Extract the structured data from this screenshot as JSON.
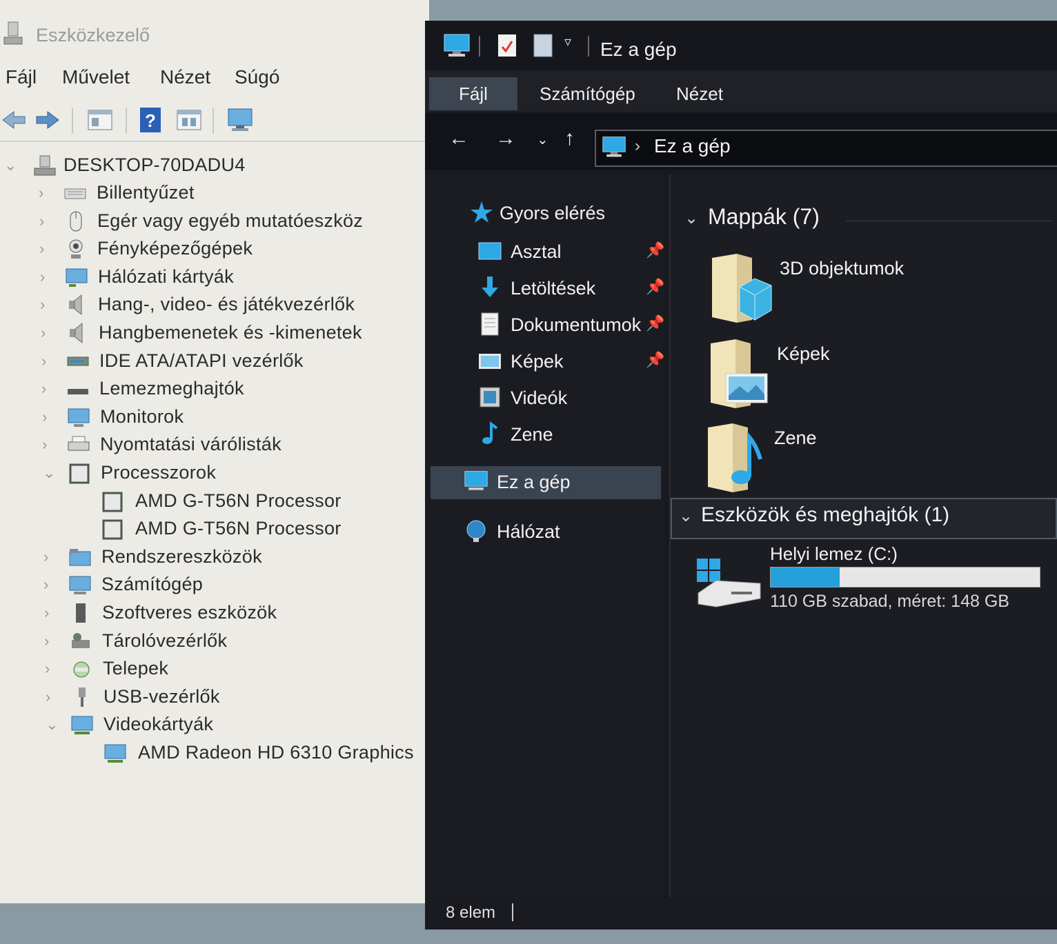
{
  "device_manager": {
    "title": "Eszközkezelő",
    "menu": [
      "Fájl",
      "Művelet",
      "Nézet",
      "Súgó"
    ],
    "toolbar_icons": [
      "back-arrow-icon",
      "forward-arrow-icon",
      "properties-icon",
      "help-icon",
      "update-driver-icon",
      "scan-hardware-icon"
    ],
    "root": "DESKTOP-70DADU4",
    "categories": [
      {
        "label": "Billentyűzet",
        "icon": "keyboard-icon",
        "expanded": false
      },
      {
        "label": "Egér vagy egyéb mutatóeszköz",
        "icon": "mouse-icon",
        "expanded": false
      },
      {
        "label": "Fényképezőgépek",
        "icon": "camera-icon",
        "expanded": false
      },
      {
        "label": "Hálózati kártyák",
        "icon": "network-adapter-icon",
        "expanded": false
      },
      {
        "label": "Hang-, video- és játékvezérlők",
        "icon": "speaker-icon",
        "expanded": false
      },
      {
        "label": "Hangbemenetek és -kimenetek",
        "icon": "speaker-icon",
        "expanded": false
      },
      {
        "label": "IDE ATA/ATAPI vezérlők",
        "icon": "ide-controller-icon",
        "expanded": false
      },
      {
        "label": "Lemezmeghajtók",
        "icon": "disk-drive-icon",
        "expanded": false
      },
      {
        "label": "Monitorok",
        "icon": "monitor-icon",
        "expanded": false
      },
      {
        "label": "Nyomtatási várólisták",
        "icon": "printer-icon",
        "expanded": false
      },
      {
        "label": "Processzorok",
        "icon": "processor-icon",
        "expanded": true,
        "children": [
          "AMD G-T56N Processor",
          "AMD G-T56N Processor"
        ]
      },
      {
        "label": "Rendszereszközök",
        "icon": "system-devices-icon",
        "expanded": false
      },
      {
        "label": "Számítógép",
        "icon": "computer-icon",
        "expanded": false
      },
      {
        "label": "Szoftveres eszközök",
        "icon": "software-device-icon",
        "expanded": false
      },
      {
        "label": "Tárolóvezérlők",
        "icon": "storage-controller-icon",
        "expanded": false
      },
      {
        "label": "Telepek",
        "icon": "battery-icon",
        "expanded": false
      },
      {
        "label": "USB-vezérlők",
        "icon": "usb-icon",
        "expanded": false
      },
      {
        "label": "Videokártyák",
        "icon": "display-adapter-icon",
        "expanded": true,
        "children": [
          "AMD Radeon HD 6310 Graphics"
        ]
      }
    ]
  },
  "explorer": {
    "title": "Ez a gép",
    "ribbon_tabs": [
      "Fájl",
      "Számítógép",
      "Nézet"
    ],
    "address": "Ez a gép",
    "nav_quick_access": "Gyors elérés",
    "nav_items": [
      {
        "label": "Asztal",
        "icon": "desktop-folder-icon",
        "pinned": true
      },
      {
        "label": "Letöltések",
        "icon": "downloads-icon",
        "pinned": true
      },
      {
        "label": "Dokumentumok",
        "icon": "documents-icon",
        "pinned": true
      },
      {
        "label": "Képek",
        "icon": "pictures-icon",
        "pinned": true
      },
      {
        "label": "Videók",
        "icon": "videos-icon",
        "pinned": false
      },
      {
        "label": "Zene",
        "icon": "music-icon",
        "pinned": false
      }
    ],
    "nav_this_pc": "Ez a gép",
    "nav_network": "Hálózat",
    "folders_header": "Mappák (7)",
    "folders": [
      {
        "label": "3D objektumok",
        "icon": "3d-objects-folder-icon"
      },
      {
        "label": "Képek",
        "icon": "pictures-folder-icon"
      },
      {
        "label": "Zene",
        "icon": "music-folder-icon"
      }
    ],
    "devices_header": "Eszközök és meghajtók (1)",
    "drive": {
      "label": "Helyi lemez (C:)",
      "free_text": "110 GB szabad, méret: 148 GB",
      "used_fraction": 0.257,
      "bar_color": "#26a0da"
    },
    "status": "8 elem"
  }
}
